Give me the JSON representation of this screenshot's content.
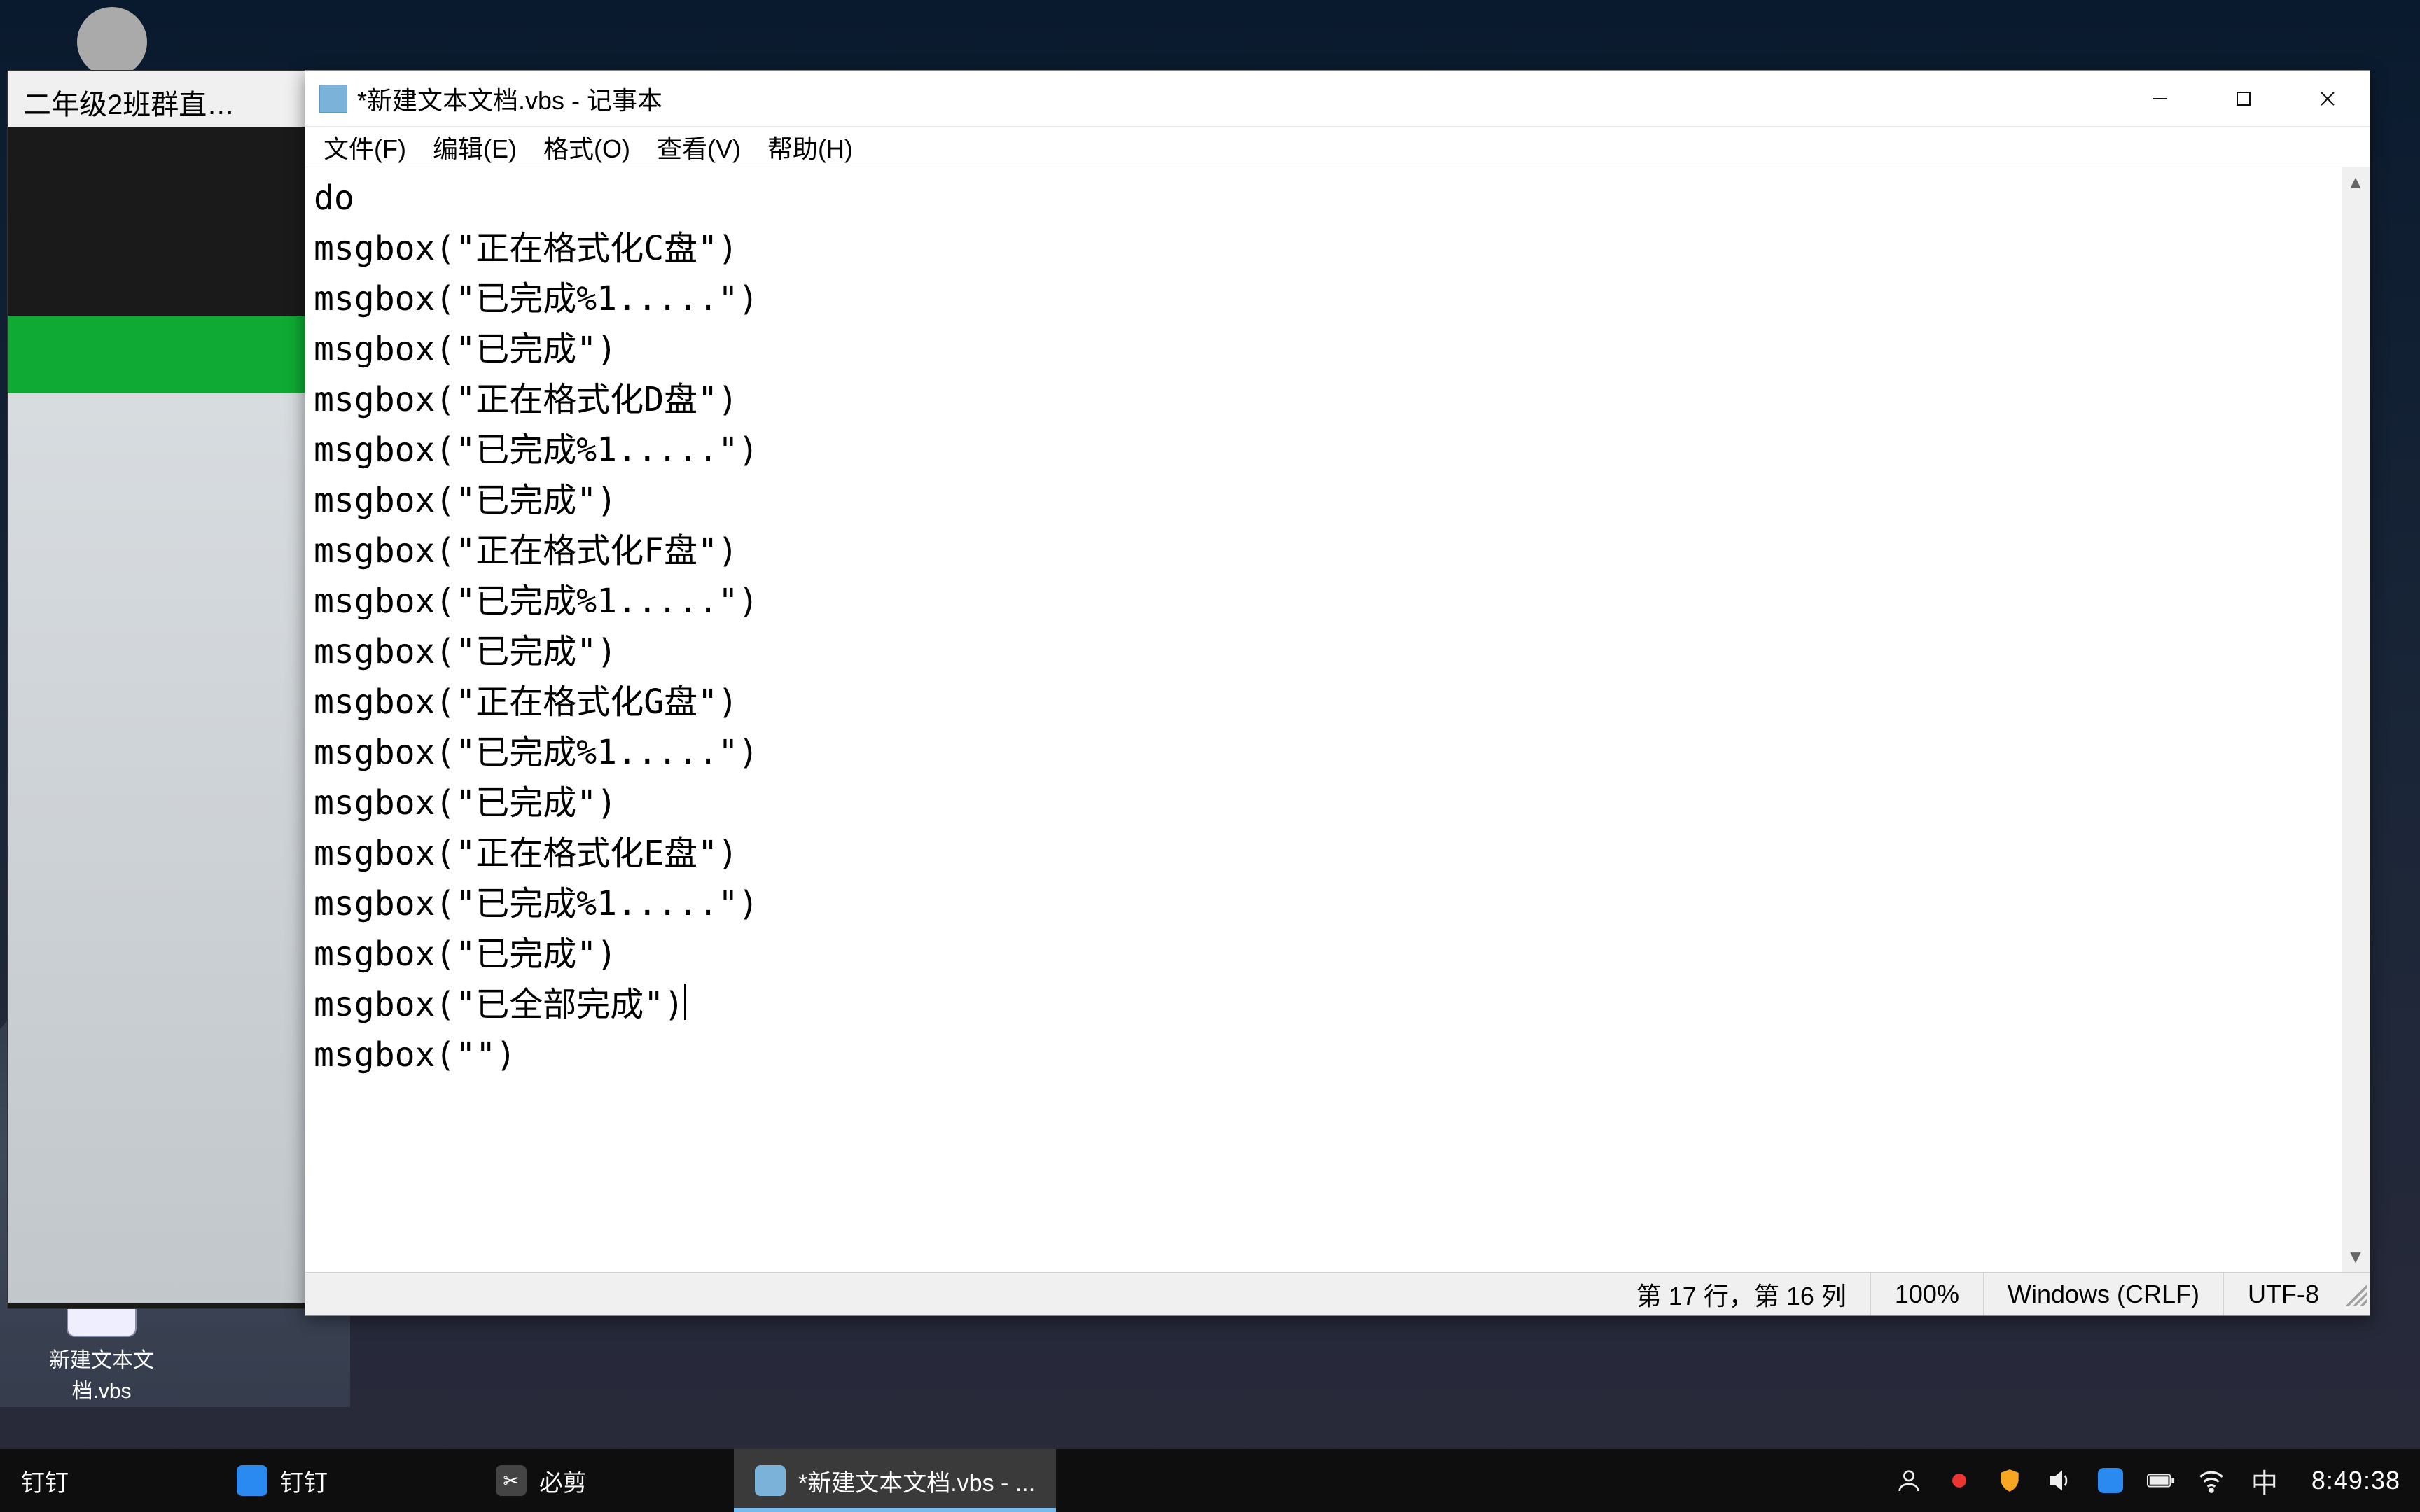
{
  "desktop": {
    "dingding_label": "",
    "vbs_label": "新建文本文\n档.vbs"
  },
  "bg_window": {
    "title": "二年级2班群直…"
  },
  "notepad": {
    "title": "*新建文本文档.vbs - 记事本",
    "menus": {
      "file": "文件(F)",
      "edit": "编辑(E)",
      "format": "格式(O)",
      "view": "查看(V)",
      "help": "帮助(H)"
    },
    "lines": [
      "do",
      "msgbox(\"正在格式化C盘\")",
      "msgbox(\"已完成%1.....\")",
      "msgbox(\"已完成\")",
      "msgbox(\"正在格式化D盘\")",
      "msgbox(\"已完成%1.....\")",
      "msgbox(\"已完成\")",
      "msgbox(\"正在格式化F盘\")",
      "msgbox(\"已完成%1.....\")",
      "msgbox(\"已完成\")",
      "msgbox(\"正在格式化G盘\")",
      "msgbox(\"已完成%1.....\")",
      "msgbox(\"已完成\")",
      "msgbox(\"正在格式化E盘\")",
      "msgbox(\"已完成%1.....\")",
      "msgbox(\"已完成\")",
      "msgbox(\"已全部完成\")",
      "msgbox(\"\")"
    ],
    "caret_line_index": 16,
    "status": {
      "pos": "第 17 行，第 16 列",
      "zoom": "100%",
      "eol": "Windows (CRLF)",
      "encoding": "UTF-8"
    }
  },
  "taskbar": {
    "search_label": "钉钉",
    "dingding_label": "钉钉",
    "bijian_label": "必剪",
    "notepad_label": "*新建文本文档.vbs - ...",
    "ime": "中",
    "clock": "8:49:38"
  },
  "tray_icons": {
    "person": "person-icon",
    "record": "record-icon",
    "shield": "shield-icon",
    "volume": "volume-icon",
    "app": "app-icon",
    "battery": "battery-icon",
    "wifi": "wifi-icon"
  },
  "colors": {
    "taskbar_active": "#3a3a3a",
    "accent_underline": "#76b9ed",
    "greenbar": "#0faa33"
  }
}
